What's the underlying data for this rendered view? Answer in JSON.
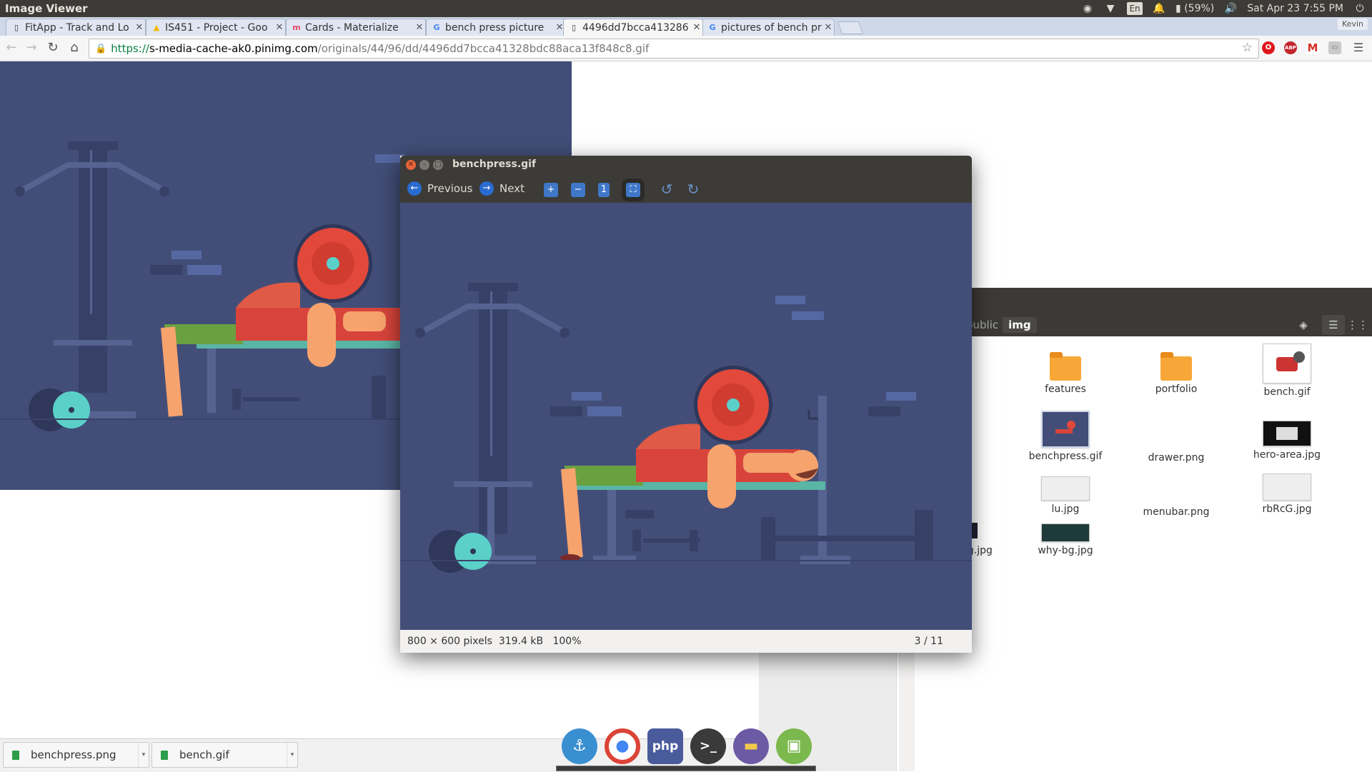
{
  "panel": {
    "title": "Image Viewer",
    "battery": "(59%)",
    "datetime": "Sat Apr 23  7:55 PM",
    "lang": "En"
  },
  "tabs": [
    {
      "label": "FitApp - Track and Lo",
      "icon": "page-icon"
    },
    {
      "label": "IS451 - Project - Goo",
      "icon": "drive-icon"
    },
    {
      "label": "Cards - Materialize",
      "icon": "materialize-icon"
    },
    {
      "label": "bench press picture",
      "icon": "google-icon"
    },
    {
      "label": "4496dd7bcca413286",
      "icon": "page-icon"
    },
    {
      "label": "pictures of bench pr",
      "icon": "google-icon"
    }
  ],
  "profile": "Kevin",
  "url": {
    "scheme": "https://",
    "host": "s-media-cache-ak0.pinimg.com",
    "path": "/originals/44/96/dd/4496dd7bcca41328bdc88aca13f848c8.gif"
  },
  "viewer": {
    "title": "benchpress.gif",
    "prev_label": "Previous",
    "next_label": "Next",
    "dims": "800 × 600 pixels",
    "size": "319.4 kB",
    "zoom": "100%",
    "count": "3 / 11"
  },
  "files": {
    "path": [
      "public",
      "img"
    ],
    "items": [
      {
        "name": "features",
        "type": "folder"
      },
      {
        "name": "portfolio",
        "type": "folder"
      },
      {
        "name": "bench.gif",
        "type": "image"
      },
      {
        "name": "benchpress.gif",
        "type": "image"
      },
      {
        "name": "drawer.png",
        "type": "image"
      },
      {
        "name": "hero-area.jpg",
        "type": "image"
      },
      {
        "name": "lu.jpg",
        "type": "image"
      },
      {
        "name": "menubar.png",
        "type": "image"
      },
      {
        "name": "rbRcG.jpg",
        "type": "image"
      },
      {
        "name": "why-bg.jpg",
        "type": "image"
      },
      {
        "name": "g",
        "type": "image"
      },
      {
        "name": "bg.jpg",
        "type": "image"
      }
    ]
  },
  "downloads": [
    {
      "name": "benchpress.png"
    },
    {
      "name": "bench.gif"
    }
  ],
  "dock": [
    "anchor-icon",
    "chrome-icon",
    "php-icon",
    "terminal-icon",
    "files-icon",
    "image-viewer-icon"
  ],
  "colors": {
    "illustration_bg": "#424e78",
    "plate_red": "#e2493b",
    "shirt_red": "#d8443b",
    "accent_teal": "#5ad0c9"
  }
}
